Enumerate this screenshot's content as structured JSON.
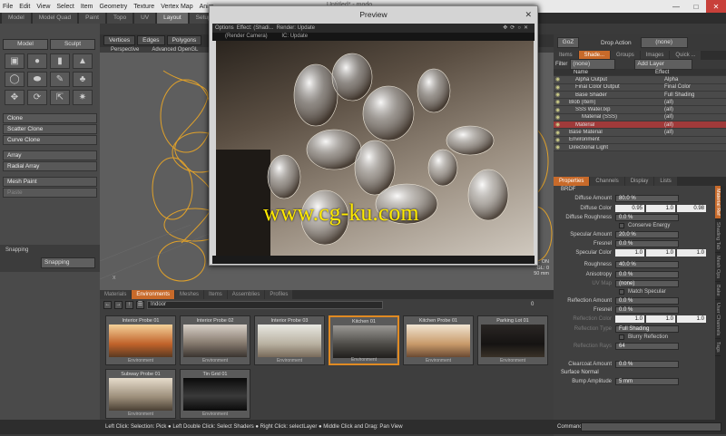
{
  "menubar": {
    "items": [
      "File",
      "Edit",
      "View",
      "Select",
      "Item",
      "Geometry",
      "Texture",
      "Vertex Map",
      "Anim"
    ],
    "window_title": "Untitled* - modo"
  },
  "layout_tabs": [
    "Model",
    "Model Quad",
    "Paint",
    "Topo",
    "UV",
    "Layout",
    "Setup"
  ],
  "layout_active": "Layout",
  "left": {
    "tabs": [
      "Model",
      "Sculpt"
    ],
    "icons": [
      "cube-icon",
      "sphere-icon",
      "cylinder-icon",
      "cone-icon",
      "torus-icon",
      "capsule-icon",
      "pen-icon",
      "tree-icon",
      "move-icon",
      "rotate-icon",
      "scale-icon",
      "transform-icon"
    ],
    "tools_a": [
      "Clone",
      "Scatter Clone",
      "Curve Clone"
    ],
    "tools_b": [
      "Array",
      "Radial Array"
    ],
    "tools_c": [
      "Mesh Paint",
      "Paste"
    ],
    "snapping_label": "Snapping",
    "snapping_btn": "Snapping"
  },
  "viewport": {
    "toolbar": [
      "Vertices",
      "Edges",
      "Polygons"
    ],
    "view_label": "Perspective",
    "render_label": "Advanced OpenGL",
    "info": [
      "Deformers: ON",
      "GL: 0",
      "50 mm"
    ]
  },
  "preview": {
    "title": "Preview",
    "toolbar": [
      "Options",
      "Effect: (Shadi...",
      "Render: Update"
    ],
    "sub": "(Render Camera)",
    "sub2": "IC: Update",
    "watermark": "www.cg-ku.com"
  },
  "right": {
    "goz": "GoZ",
    "drop_action_label": "Drop Action",
    "drop_action_value": "(none)",
    "tabs": [
      "Items",
      "Shade...",
      "Groups",
      "Images",
      "Quick ..."
    ],
    "filter_label": "Filter",
    "filter_value": "(none)",
    "add_layer": "Add Layer",
    "col_name": "Name",
    "col_effect": "Effect",
    "shader_rows": [
      {
        "name": "Alpha Output",
        "effect": "Alpha",
        "sel": false,
        "indent": 2
      },
      {
        "name": "Final Color Output",
        "effect": "Final Color",
        "sel": false,
        "indent": 2
      },
      {
        "name": "Base Shader",
        "effect": "Full Shading",
        "sel": false,
        "indent": 2
      },
      {
        "name": "Blob (Item)",
        "effect": "(all)",
        "sel": false,
        "indent": 1
      },
      {
        "name": "SSS Water.lxp",
        "effect": "(all)",
        "sel": false,
        "indent": 2
      },
      {
        "name": "Material (SSS)",
        "effect": "(all)",
        "sel": false,
        "indent": 3
      },
      {
        "name": "Material",
        "effect": "(all)",
        "sel": true,
        "indent": 2
      },
      {
        "name": "Base Material",
        "effect": "(all)",
        "sel": false,
        "indent": 1
      },
      {
        "name": "Environment",
        "effect": "",
        "sel": false,
        "indent": 1
      },
      {
        "name": "Directional Light",
        "effect": "",
        "sel": false,
        "indent": 1
      }
    ],
    "prop_tabs": [
      "Properties",
      "Channels",
      "Display",
      "Lists"
    ],
    "brdf": "BRDF",
    "props": [
      {
        "label": "Diffuse Amount",
        "value": "80.0 %"
      },
      {
        "label": "Diffuse Color",
        "triple": [
          "0.95",
          "1.0",
          "0.98"
        ]
      },
      {
        "label": "Diffuse Roughness",
        "value": "0.0 %"
      }
    ],
    "conserve": "Conserve Energy",
    "props2": [
      {
        "label": "Specular Amount",
        "value": "20.0 %"
      },
      {
        "label": "Fresnel",
        "value": "0.0 %"
      },
      {
        "label": "Specular Color",
        "triple": [
          "1.0",
          "1.0",
          "1.0"
        ]
      }
    ],
    "props3": [
      {
        "label": "Roughness",
        "value": "40.0 %"
      },
      {
        "label": "Anisotropy",
        "value": "0.0 %"
      },
      {
        "label": "UV Map",
        "value": "(none)",
        "dim": true
      }
    ],
    "match_spec": "Match Specular",
    "props4": [
      {
        "label": "Reflection Amount",
        "value": "0.0 %"
      },
      {
        "label": "Fresnel",
        "value": "0.0 %"
      },
      {
        "label": "Reflection Color",
        "triple": [
          "1.0",
          "1.0",
          "1.0"
        ],
        "dim": true
      },
      {
        "label": "Reflection Type",
        "value": "Full Shading",
        "dim": true
      }
    ],
    "blurry": "Blurry Reflection",
    "props5": [
      {
        "label": "Reflection Rays",
        "value": "64",
        "dim": true
      },
      {
        "label": "",
        "value": ""
      },
      {
        "label": "Clearcoat Amount",
        "value": "0.0 %"
      }
    ],
    "surface_normal": "Surface Normal",
    "bump": {
      "label": "Bump Amplitude",
      "value": "5 mm"
    },
    "side_tabs": [
      "Material Ref",
      "Shading Tab",
      "Mesh Ops",
      "Bake",
      "User Channels",
      "Tags"
    ]
  },
  "bottom": {
    "tabs": [
      "Materials",
      "Environments",
      "Meshes",
      "Items",
      "Assemblies",
      "Profiles"
    ],
    "active": "Environments",
    "path": "Indoor",
    "count": "0",
    "thumbs": [
      {
        "title": "Interior Probe 01",
        "cap": "Environment",
        "on": false,
        "bg": "linear-gradient(#f4d29a,#c0622a 60%,#5a3a22)"
      },
      {
        "title": "Interior Probe 02",
        "cap": "Environment",
        "on": false,
        "bg": "linear-gradient(#d8d0c8,#8a7e72 55%,#3a3430)"
      },
      {
        "title": "Interior Probe 03",
        "cap": "Environment",
        "on": false,
        "bg": "linear-gradient(#e8e8e2,#b8b0a0 60%,#786a5a)"
      },
      {
        "title": "Kitchen 01",
        "cap": "Environment",
        "on": true,
        "bg": "linear-gradient(#9a9894,#4a4844 60%,#201e1c)"
      },
      {
        "title": "Kitchen Probe 01",
        "cap": "Environment",
        "on": false,
        "bg": "linear-gradient(#f0e4d2,#c89a6a 60%,#6a4a32)"
      },
      {
        "title": "Parking Lot 01",
        "cap": "Environment",
        "on": false,
        "bg": "linear-gradient(#2a2624,#151312 60%,#3a3228)"
      },
      {
        "title": "Subway Probe 01",
        "cap": "Environment",
        "on": false,
        "bg": "linear-gradient(#e6dccc,#9a8c78 60%,#4a4034)"
      },
      {
        "title": "Tin Grid 01",
        "cap": "Environment",
        "on": false,
        "bg": "linear-gradient(#0a0a0a,#3a3a3a 55%,#0a0a0a)"
      }
    ]
  },
  "status": "Left Click: Selection: Pick ● Left Double Click: Select Shaders ● Right Click: selectLayer ● Middle Click and Drag: Pan View",
  "command_label": "Command"
}
